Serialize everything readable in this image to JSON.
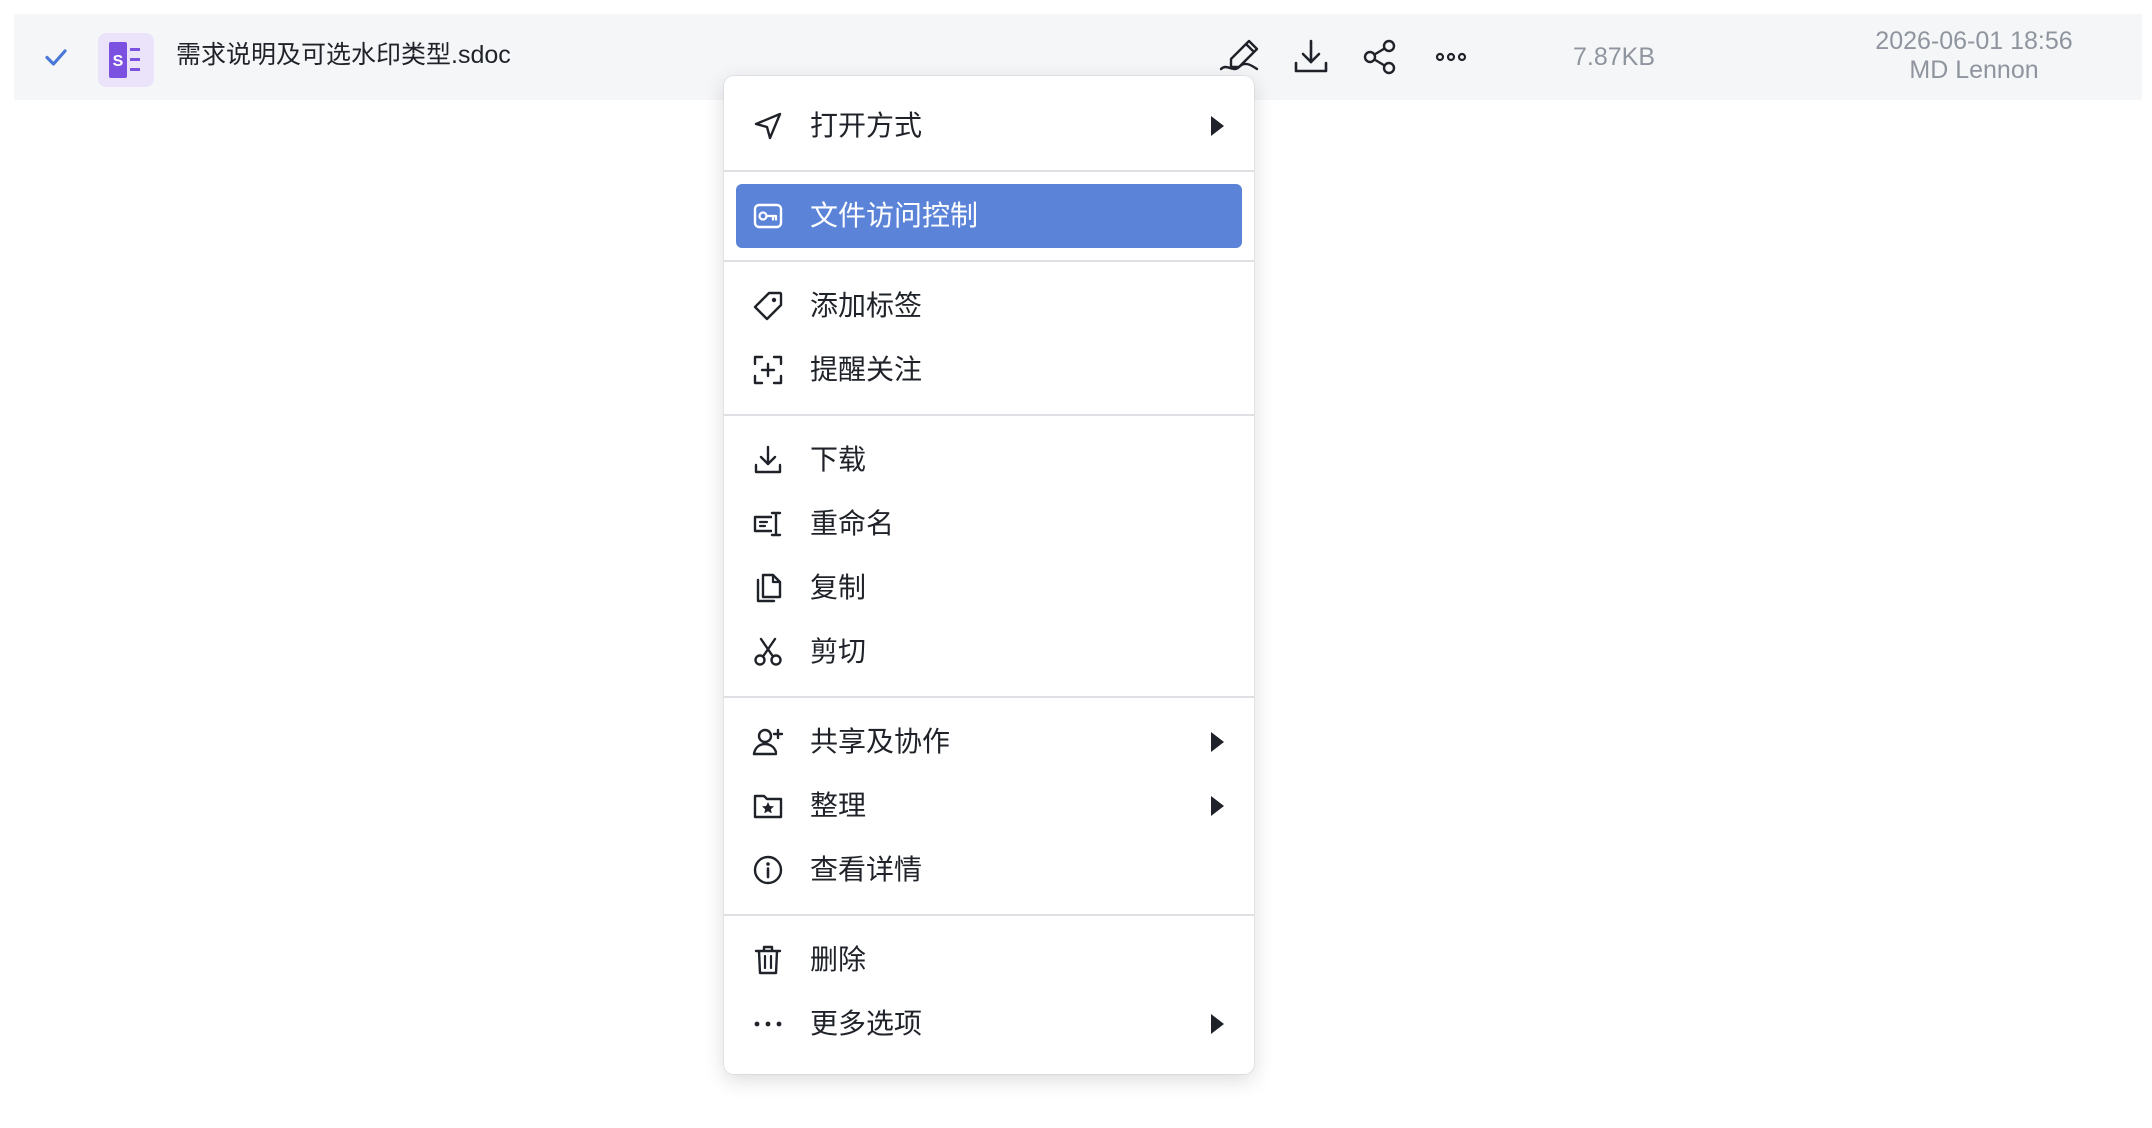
{
  "file_row": {
    "file_name": "需求说明及可选水印类型.sdoc",
    "file_icon_letter": "S",
    "file_icon_color": "#7b52e0",
    "size": "7.87KB",
    "date": "2026-06-01 18:56",
    "owner": "MD Lennon",
    "actions": [
      {
        "icon": "edit-icon"
      },
      {
        "icon": "download-icon"
      },
      {
        "icon": "share-icon"
      },
      {
        "icon": "more-icon"
      }
    ],
    "checked": true
  },
  "context_menu": {
    "accent_color": "#5b84d9",
    "items": {
      "open_with": {
        "label": "打开方式",
        "icon": "navigation-arrow-icon",
        "has_submenu": true
      },
      "access_control": {
        "label": "文件访问控制",
        "icon": "key-box-icon",
        "highlighted": true
      },
      "add_tag": {
        "label": "添加标签",
        "icon": "tag-icon"
      },
      "remind": {
        "label": "提醒关注",
        "icon": "add-watch-icon"
      },
      "download": {
        "label": "下载",
        "icon": "download-icon"
      },
      "rename": {
        "label": "重命名",
        "icon": "rename-icon"
      },
      "copy": {
        "label": "复制",
        "icon": "copy-icon"
      },
      "cut": {
        "label": "剪切",
        "icon": "scissors-icon"
      },
      "share_collab": {
        "label": "共享及协作",
        "icon": "add-user-icon",
        "has_submenu": true
      },
      "organize": {
        "label": "整理",
        "icon": "folder-star-icon",
        "has_submenu": true
      },
      "details": {
        "label": "查看详情",
        "icon": "info-icon"
      },
      "delete": {
        "label": "删除",
        "icon": "trash-icon"
      },
      "more_options": {
        "label": "更多选项",
        "icon": "ellipsis-icon",
        "has_submenu": true
      }
    }
  }
}
